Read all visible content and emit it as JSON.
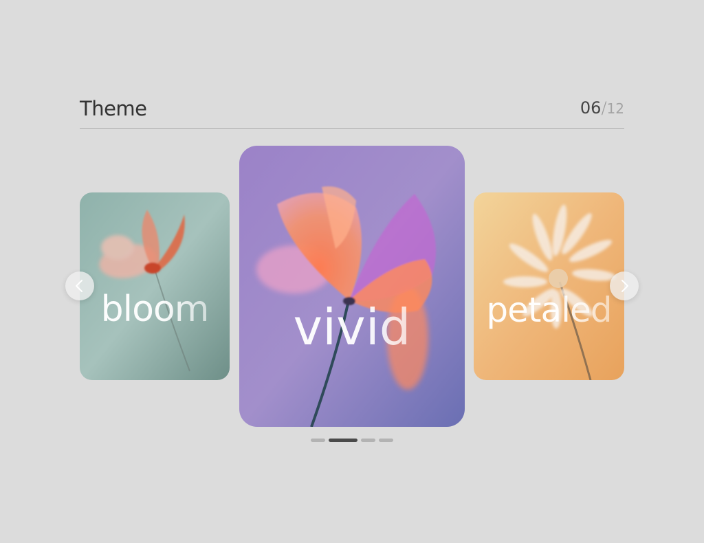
{
  "header": {
    "title": "Theme",
    "counter_current": "06",
    "counter_separator": "/",
    "counter_total": "12"
  },
  "cards": [
    {
      "word": "bloom",
      "palette": "sage-green",
      "flower_color": "#e0603a"
    },
    {
      "word": "vivid",
      "palette": "violet",
      "flower_color": "#f28a5c"
    },
    {
      "word": "petaled",
      "palette": "peach-orange",
      "flower_color": "#f4e6d8"
    }
  ],
  "navigation": {
    "prev_icon": "chevron-left-icon",
    "next_icon": "chevron-right-icon"
  },
  "pagination": {
    "count": 4,
    "active_index": 1
  },
  "colors": {
    "background": "#dcdcdc",
    "title": "#333333",
    "divider": "#a9a9a9",
    "active_dot": "#4a4a4a",
    "inactive_dot": "#b3b3b3"
  }
}
